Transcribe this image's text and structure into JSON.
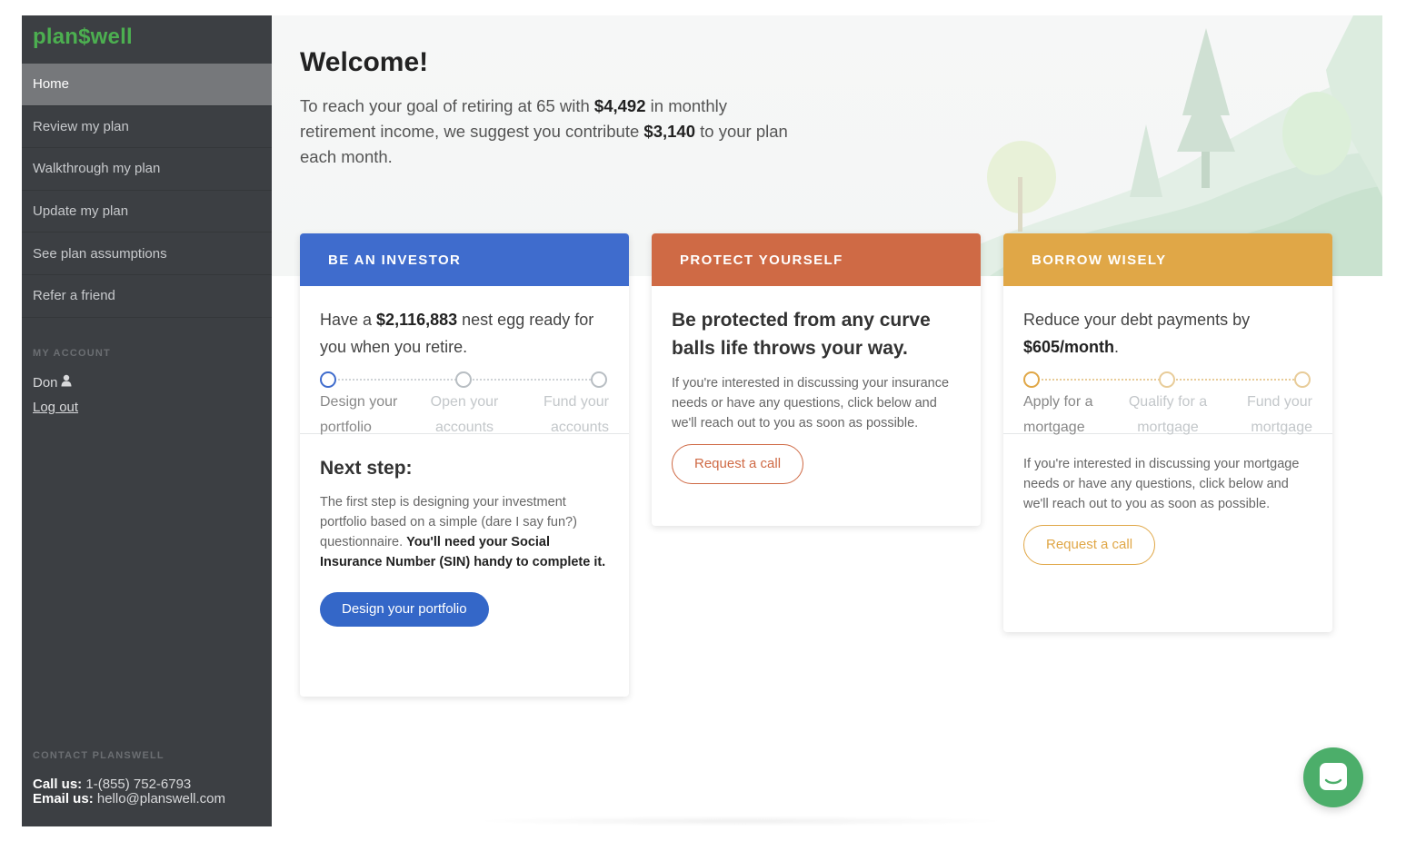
{
  "brand": {
    "logo_text": "plan$well",
    "logo_color": "#4caf50"
  },
  "sidebar": {
    "items": [
      {
        "label": "Home",
        "active": true
      },
      {
        "label": "Review my plan"
      },
      {
        "label": "Walkthrough my plan"
      },
      {
        "label": "Update my plan"
      },
      {
        "label": "See plan assumptions"
      },
      {
        "label": "Refer a friend"
      }
    ],
    "account_heading": "MY ACCOUNT",
    "user_name": "Don",
    "logout_label": "Log out",
    "contact_heading": "CONTACT PLANSWELL",
    "call_label": "Call us:",
    "call_value": "1-(855) 752-6793",
    "email_label": "Email us:",
    "email_value": "hello@planswell.com"
  },
  "main": {
    "title": "Welcome!",
    "intro": {
      "part1": "To reach your goal of retiring at 65 with ",
      "income": "$4,492",
      "part2": " in monthly retirement income, we suggest you contribute ",
      "contribution": "$3,140",
      "part3": " to your plan each month."
    }
  },
  "cards": {
    "invest": {
      "header": "BE AN INVESTOR",
      "color": "#3f6ccd",
      "lead1": "Have a ",
      "nest_egg": "$2,116,883",
      "lead2": " nest egg ready for you when you retire.",
      "steps": [
        "Design your portfolio",
        "Open your accounts",
        "Fund your accounts"
      ],
      "next_title": "Next step:",
      "next_text": "The first step is designing your investment portfolio based on a simple (dare I say fun?) questionnaire. ",
      "next_bold": "You'll need your Social Insurance Number (SIN) handy to complete it.",
      "button": "Design your portfolio"
    },
    "protect": {
      "header": "PROTECT YOURSELF",
      "color": "#cf6a45",
      "lead": "Be protected from any curve balls life throws your way.",
      "text": "If you're interested in discussing your insurance needs or have any questions, click below and we'll reach out to you as soon as possible.",
      "button": "Request a call"
    },
    "borrow": {
      "header": "BORROW WISELY",
      "color": "#e0a747",
      "lead1": "Reduce your debt payments by ",
      "amount": "$605/month",
      "lead2": ".",
      "steps": [
        "Apply for a mortgage",
        "Qualify for a mortgage",
        "Fund your mortgage"
      ],
      "text": "If you're interested in discussing your mortgage needs or have any questions, click below and we'll reach out to you as soon as possible.",
      "button": "Request a call"
    }
  },
  "chat": {
    "icon": "chat-icon",
    "color": "#4cae6a"
  }
}
